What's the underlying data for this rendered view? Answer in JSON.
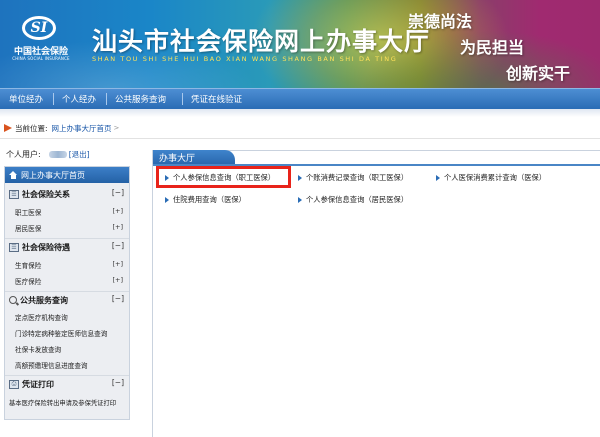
{
  "banner": {
    "logo_mark": "SI",
    "logo_cn": "中国社会保险",
    "logo_en": "CHINA SOCIAL INSURANCE",
    "title": "汕头市社会保险网上办事大厅",
    "pinyin": "SHAN TOU SHI SHE HUI BAO XIAN WANG SHANG BAN SHI DA TING",
    "slogans": [
      "崇德尚法",
      "为民担当",
      "创新实干"
    ]
  },
  "nav": {
    "items": [
      "单位经办",
      "个人经办",
      "公共服务查询",
      "凭证在线验证"
    ]
  },
  "breadcrumb": {
    "label": "当前位置:",
    "link": "网上办事大厅首页",
    "arrow": ">"
  },
  "user": {
    "label": "个人用户:",
    "exit": "[退出]"
  },
  "sidebar": {
    "home": "网上办事大厅首页",
    "groups": [
      {
        "title": "社会保险关系",
        "toggle": "[−]",
        "items": [
          {
            "label": "职工医保",
            "plus": "[+]"
          },
          {
            "label": "居民医保",
            "plus": "[+]"
          }
        ]
      },
      {
        "title": "社会保险待遇",
        "toggle": "[−]",
        "items": [
          {
            "label": "生育保险",
            "plus": "[+]"
          },
          {
            "label": "医疗保险",
            "plus": "[+]"
          }
        ]
      },
      {
        "title": "公共服务查询",
        "toggle": "[−]",
        "items": [
          {
            "label": "定点医疗机构查询"
          },
          {
            "label": "门诊特定病种鉴定医师信息查询"
          },
          {
            "label": "社保卡发放查询"
          },
          {
            "label": "高额预缴理信息进度查询"
          }
        ]
      },
      {
        "title": "凭证打印",
        "toggle": "[−]",
        "items": [
          {
            "label": "基本医疗保险转出申请及参保凭证打印"
          }
        ]
      }
    ]
  },
  "main": {
    "tab": "办事大厅",
    "services": [
      "个人参保信息查询（职工医保）",
      "个账消费记录查询（职工医保）",
      "个人医保消费累计查询（医保）",
      "住院费用查询（医保）",
      "个人参保信息查询（居民医保）"
    ]
  },
  "colors": {
    "nav_blue": "#2a6cb5",
    "highlight_red": "#e8231a",
    "link_blue": "#1a57a8"
  }
}
